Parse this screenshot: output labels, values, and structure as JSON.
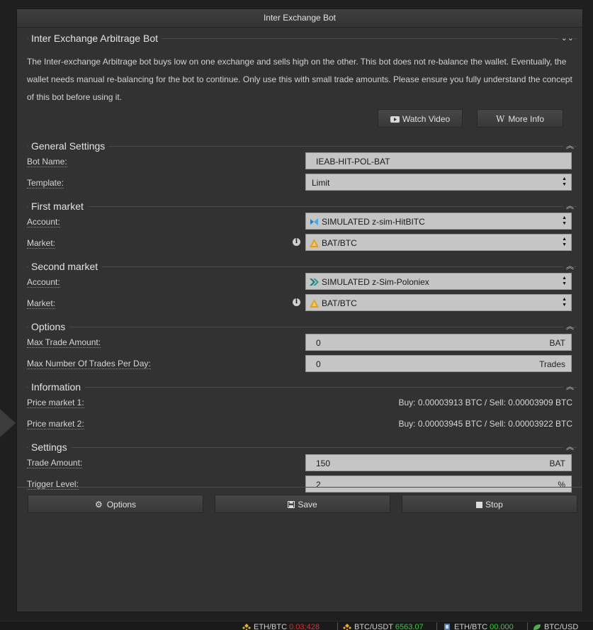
{
  "window": {
    "title": "Inter Exchange Bot"
  },
  "intro": {
    "title": "Inter Exchange Arbitrage Bot",
    "description": "The Inter-exchange Arbitrage bot buys low on one exchange and sells high on the other. This bot does not re-balance the wallet. Eventually, the wallet needs manual re-balancing for the bot to continue. Only use this with small trade amounts. Please ensure you fully understand the concept of this bot before using it.",
    "watch_video": "Watch Video",
    "more_info": "More Info",
    "more_info_icon": "W"
  },
  "general": {
    "title": "General Settings",
    "bot_name_label": "Bot Name:",
    "bot_name_value": "IEAB-HIT-POL-BAT",
    "template_label": "Template:",
    "template_value": "Limit"
  },
  "first_market": {
    "title": "First market",
    "account_label": "Account:",
    "account_value": "SIMULATED z-sim-HitBITC",
    "market_label": "Market:",
    "market_value": "BAT/BTC"
  },
  "second_market": {
    "title": "Second market",
    "account_label": "Account:",
    "account_value": "SIMULATED z-Sim-Poloniex",
    "market_label": "Market:",
    "market_value": "BAT/BTC"
  },
  "options": {
    "title": "Options",
    "max_trade_amount_label": "Max Trade Amount:",
    "max_trade_amount_value": "0",
    "max_trade_amount_unit": "BAT",
    "max_trades_label": "Max Number Of Trades Per Day:",
    "max_trades_value": "0",
    "max_trades_unit": "Trades"
  },
  "information": {
    "title": "Information",
    "price1_label": "Price market 1:",
    "price1_value": "Buy: 0.00003913 BTC / Sell: 0.00003909 BTC",
    "price2_label": "Price market 2:",
    "price2_value": "Buy: 0.00003945 BTC / Sell: 0.00003922 BTC"
  },
  "settings": {
    "title": "Settings",
    "trade_amount_label": "Trade Amount:",
    "trade_amount_value": "150",
    "trade_amount_unit": "BAT",
    "trigger_level_label": "Trigger Level:",
    "trigger_level_value": "2",
    "trigger_level_unit": "%"
  },
  "footer": {
    "options": "Options",
    "save": "Save",
    "stop": "Stop"
  },
  "status_bar": {
    "t1_pair": "ETH/BTC",
    "t1_value": "0.03;428",
    "t2_pair": "BTC/USDT",
    "t2_value": "6563.07",
    "t3_pair": "ETH/BTC",
    "t3_value": "00.000",
    "t4_pair": "BTC/USD"
  },
  "colors": {
    "negative": "#e03030",
    "positive": "#30d030",
    "field_bg": "#c5c5c5"
  },
  "icons": {
    "collapse": "chevron-up-double-icon",
    "expand": "chevron-down-double-icon"
  }
}
